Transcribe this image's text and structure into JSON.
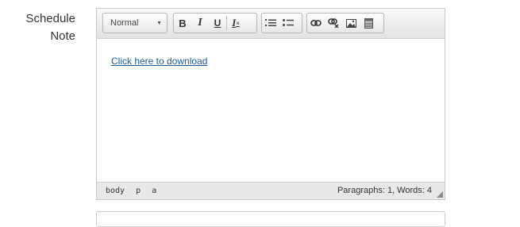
{
  "label": {
    "line1": "Schedule",
    "line2": "Note"
  },
  "toolbar": {
    "format_value": "Normal",
    "buttons": {
      "bold": "B",
      "italic": "I",
      "underline": "U",
      "remove_format": "I"
    },
    "icons": [
      "bold-icon",
      "italic-icon",
      "underline-icon",
      "remove-format-icon",
      "numbered-list-icon",
      "bulleted-list-icon",
      "link-icon",
      "unlink-icon",
      "image-icon",
      "table-icon"
    ]
  },
  "content": {
    "link_text": "Click here to download"
  },
  "status": {
    "path": [
      "body",
      "p",
      "a"
    ],
    "word_count": "Paragraphs: 1, Words: 4"
  },
  "colors": {
    "link": "#1a5b9e",
    "toolbar_bg": "#e3e3e3",
    "status_bg": "#e8e8e8"
  }
}
